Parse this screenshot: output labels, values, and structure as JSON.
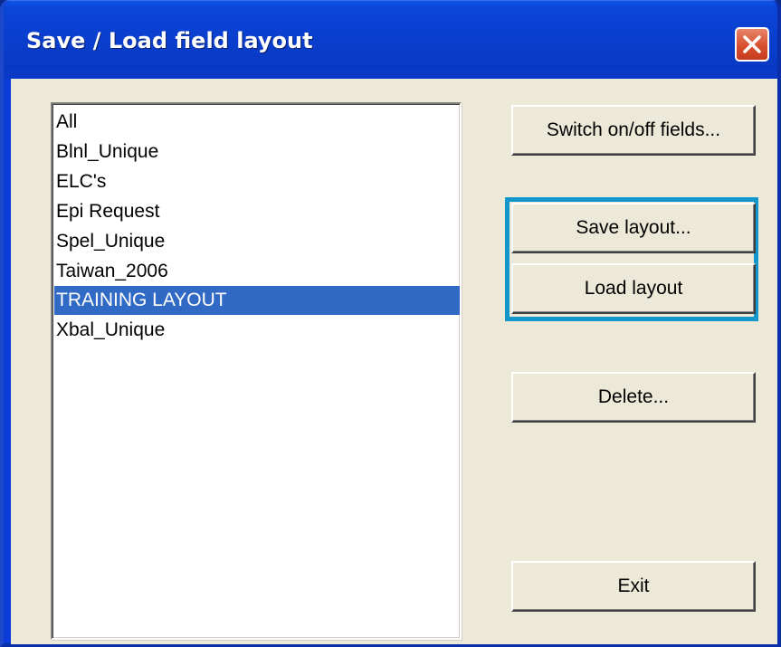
{
  "window": {
    "title": "Save / Load field layout"
  },
  "titlebar": {
    "close_icon": "close-icon"
  },
  "layouts": {
    "items": [
      {
        "label": "All",
        "selected": false
      },
      {
        "label": "Blnl_Unique",
        "selected": false
      },
      {
        "label": "ELC's",
        "selected": false
      },
      {
        "label": "Epi Request",
        "selected": false
      },
      {
        "label": "Spel_Unique",
        "selected": false
      },
      {
        "label": "Taiwan_2006",
        "selected": false
      },
      {
        "label": "TRAINING LAYOUT",
        "selected": true
      },
      {
        "label": "Xbal_Unique",
        "selected": false
      }
    ]
  },
  "buttons": {
    "switch_fields": "Switch on/off fields...",
    "save_layout": "Save layout...",
    "load_layout": "Load layout",
    "delete": "Delete...",
    "exit": "Exit"
  },
  "colors": {
    "titlebar": "#0a3fcf",
    "selection": "#316ac5",
    "dialog_face": "#ece9d8",
    "highlight_frame": "#1296cc"
  }
}
